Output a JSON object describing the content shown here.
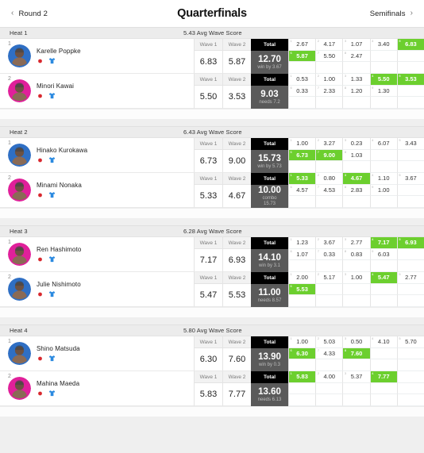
{
  "nav": {
    "prev_label": "Round 2",
    "prev_icon": "chevron-left-icon",
    "title": "Quarterfinals",
    "next_label": "Semifinals",
    "next_icon": "chevron-right-icon"
  },
  "columns": {
    "wave1": "Wave 1",
    "wave2": "Wave 2",
    "total": "Total"
  },
  "colors": {
    "highlight_green": "#6ccf2e",
    "total_header_bg": "#000000",
    "total_value_bg": "#5a5a5a",
    "heat_header_bg": "#ececec",
    "page_bg": "#efefef"
  },
  "heats": [
    {
      "label": "Heat 1",
      "avg": "5.43 Avg Wave Score",
      "athletes": [
        {
          "rank": "1",
          "name": "Karelle Poppke",
          "avatar_color": "#2f6fc4",
          "flag_icon": "flag-icon",
          "jersey_icon": "jersey-icon",
          "wave1": "6.83",
          "wave2": "5.87",
          "total": "12.70",
          "note": "win by 3.67",
          "note2": "",
          "waves": [
            [
              {
                "v": "2.67",
                "n": "1",
                "hl": false
              },
              {
                "v": "4.17",
                "n": "2",
                "hl": false
              },
              {
                "v": "1.07",
                "n": "3",
                "hl": false
              },
              {
                "v": "3.40",
                "n": "4",
                "hl": false
              },
              {
                "v": "6.83",
                "n": "5",
                "hl": true
              }
            ],
            [
              {
                "v": "5.87",
                "n": "6",
                "hl": true
              },
              {
                "v": "5.50",
                "n": "7",
                "hl": false
              },
              {
                "v": "2.47",
                "n": "8",
                "hl": false
              },
              {
                "v": "",
                "n": "",
                "hl": false
              },
              {
                "v": "",
                "n": "",
                "hl": false
              }
            ],
            [
              {
                "v": "",
                "n": "",
                "hl": false
              },
              {
                "v": "",
                "n": "",
                "hl": false
              },
              {
                "v": "",
                "n": "",
                "hl": false
              },
              {
                "v": "",
                "n": "",
                "hl": false
              },
              {
                "v": "",
                "n": "",
                "hl": false
              }
            ]
          ]
        },
        {
          "rank": "2",
          "name": "Minori Kawai",
          "avatar_color": "#e0209a",
          "flag_icon": "flag-icon",
          "jersey_icon": "jersey-icon",
          "wave1": "5.50",
          "wave2": "3.53",
          "total": "9.03",
          "note": "needs 7.2",
          "note2": "",
          "waves": [
            [
              {
                "v": "0.53",
                "n": "1",
                "hl": false
              },
              {
                "v": "1.00",
                "n": "2",
                "hl": false
              },
              {
                "v": "1.33",
                "n": "3",
                "hl": false
              },
              {
                "v": "5.50",
                "n": "4",
                "hl": true
              },
              {
                "v": "3.53",
                "n": "5",
                "hl": true
              }
            ],
            [
              {
                "v": "0.33",
                "n": "6",
                "hl": false
              },
              {
                "v": "2.33",
                "n": "7",
                "hl": false
              },
              {
                "v": "1.20",
                "n": "8",
                "hl": false
              },
              {
                "v": "1.30",
                "n": "9",
                "hl": false
              },
              {
                "v": "",
                "n": "",
                "hl": false
              }
            ],
            [
              {
                "v": "",
                "n": "",
                "hl": false
              },
              {
                "v": "",
                "n": "",
                "hl": false
              },
              {
                "v": "",
                "n": "",
                "hl": false
              },
              {
                "v": "",
                "n": "",
                "hl": false
              },
              {
                "v": "",
                "n": "",
                "hl": false
              }
            ]
          ]
        }
      ]
    },
    {
      "label": "Heat 2",
      "avg": "6.43 Avg Wave Score",
      "athletes": [
        {
          "rank": "1",
          "name": "Hinako Kurokawa",
          "avatar_color": "#2f6fc4",
          "flag_icon": "flag-icon",
          "jersey_icon": "jersey-icon",
          "wave1": "6.73",
          "wave2": "9.00",
          "total": "15.73",
          "note": "win by 5.73",
          "note2": "",
          "waves": [
            [
              {
                "v": "1.00",
                "n": "1",
                "hl": false
              },
              {
                "v": "3.27",
                "n": "2",
                "hl": false
              },
              {
                "v": "0.23",
                "n": "3",
                "hl": false
              },
              {
                "v": "6.07",
                "n": "4",
                "hl": false
              },
              {
                "v": "3.43",
                "n": "5",
                "hl": false
              }
            ],
            [
              {
                "v": "6.73",
                "n": "6",
                "hl": true
              },
              {
                "v": "9.00",
                "n": "7",
                "hl": true
              },
              {
                "v": "1.03",
                "n": "8",
                "hl": false
              },
              {
                "v": "",
                "n": "",
                "hl": false
              },
              {
                "v": "",
                "n": "",
                "hl": false
              }
            ],
            [
              {
                "v": "",
                "n": "",
                "hl": false
              },
              {
                "v": "",
                "n": "",
                "hl": false
              },
              {
                "v": "",
                "n": "",
                "hl": false
              },
              {
                "v": "",
                "n": "",
                "hl": false
              },
              {
                "v": "",
                "n": "",
                "hl": false
              }
            ]
          ]
        },
        {
          "rank": "2",
          "name": "Minami Nonaka",
          "avatar_color": "#e0209a",
          "flag_icon": "flag-icon",
          "jersey_icon": "jersey-icon",
          "wave1": "5.33",
          "wave2": "4.67",
          "total": "10.00",
          "note": "combo",
          "note2": "15.73",
          "waves": [
            [
              {
                "v": "5.33",
                "n": "1",
                "hl": true
              },
              {
                "v": "0.80",
                "n": "2",
                "hl": false
              },
              {
                "v": "4.67",
                "n": "3",
                "hl": true
              },
              {
                "v": "1.10",
                "n": "4",
                "hl": false
              },
              {
                "v": "3.67",
                "n": "5",
                "hl": false
              }
            ],
            [
              {
                "v": "4.57",
                "n": "6",
                "hl": false
              },
              {
                "v": "4.53",
                "n": "7",
                "hl": false
              },
              {
                "v": "2.83",
                "n": "8",
                "hl": false
              },
              {
                "v": "1.00",
                "n": "9",
                "hl": false
              },
              {
                "v": "",
                "n": "",
                "hl": false
              }
            ],
            [
              {
                "v": "",
                "n": "",
                "hl": false
              },
              {
                "v": "",
                "n": "",
                "hl": false
              },
              {
                "v": "",
                "n": "",
                "hl": false
              },
              {
                "v": "",
                "n": "",
                "hl": false
              },
              {
                "v": "",
                "n": "",
                "hl": false
              }
            ]
          ]
        }
      ]
    },
    {
      "label": "Heat 3",
      "avg": "6.28 Avg Wave Score",
      "athletes": [
        {
          "rank": "1",
          "name": "Ren Hashimoto",
          "avatar_color": "#e0209a",
          "flag_icon": "flag-icon",
          "jersey_icon": "jersey-icon",
          "wave1": "7.17",
          "wave2": "6.93",
          "total": "14.10",
          "note": "win by 3.1",
          "note2": "",
          "waves": [
            [
              {
                "v": "1.23",
                "n": "1",
                "hl": false
              },
              {
                "v": "3.67",
                "n": "2",
                "hl": false
              },
              {
                "v": "2.77",
                "n": "3",
                "hl": false
              },
              {
                "v": "7.17",
                "n": "4",
                "hl": true
              },
              {
                "v": "6.93",
                "n": "5",
                "hl": true
              }
            ],
            [
              {
                "v": "1.07",
                "n": "6",
                "hl": false
              },
              {
                "v": "0.33",
                "n": "7",
                "hl": false
              },
              {
                "v": "0.83",
                "n": "8",
                "hl": false
              },
              {
                "v": "6.03",
                "n": "9",
                "hl": false
              },
              {
                "v": "",
                "n": "",
                "hl": false
              }
            ],
            [
              {
                "v": "",
                "n": "",
                "hl": false
              },
              {
                "v": "",
                "n": "",
                "hl": false
              },
              {
                "v": "",
                "n": "",
                "hl": false
              },
              {
                "v": "",
                "n": "",
                "hl": false
              },
              {
                "v": "",
                "n": "",
                "hl": false
              }
            ]
          ]
        },
        {
          "rank": "2",
          "name": "Julie Nishimoto",
          "avatar_color": "#2f6fc4",
          "flag_icon": "flag-icon",
          "jersey_icon": "jersey-icon",
          "wave1": "5.47",
          "wave2": "5.53",
          "total": "11.00",
          "note": "needs 8.57",
          "note2": "",
          "waves": [
            [
              {
                "v": "2.00",
                "n": "1",
                "hl": false
              },
              {
                "v": "5.17",
                "n": "2",
                "hl": false
              },
              {
                "v": "1.00",
                "n": "3",
                "hl": false
              },
              {
                "v": "5.47",
                "n": "4",
                "hl": true
              },
              {
                "v": "2.77",
                "n": "5",
                "hl": false
              }
            ],
            [
              {
                "v": "5.53",
                "n": "6",
                "hl": true
              },
              {
                "v": "",
                "n": "",
                "hl": false
              },
              {
                "v": "",
                "n": "",
                "hl": false
              },
              {
                "v": "",
                "n": "",
                "hl": false
              },
              {
                "v": "",
                "n": "",
                "hl": false
              }
            ],
            [
              {
                "v": "",
                "n": "",
                "hl": false
              },
              {
                "v": "",
                "n": "",
                "hl": false
              },
              {
                "v": "",
                "n": "",
                "hl": false
              },
              {
                "v": "",
                "n": "",
                "hl": false
              },
              {
                "v": "",
                "n": "",
                "hl": false
              }
            ]
          ]
        }
      ]
    },
    {
      "label": "Heat 4",
      "avg": "5.80 Avg Wave Score",
      "athletes": [
        {
          "rank": "1",
          "name": "Shino Matsuda",
          "avatar_color": "#2f6fc4",
          "flag_icon": "flag-icon",
          "jersey_icon": "jersey-icon",
          "wave1": "6.30",
          "wave2": "7.60",
          "total": "13.90",
          "note": "win by 0.3",
          "note2": "",
          "waves": [
            [
              {
                "v": "1.00",
                "n": "1",
                "hl": false
              },
              {
                "v": "5.03",
                "n": "2",
                "hl": false
              },
              {
                "v": "0.50",
                "n": "3",
                "hl": false
              },
              {
                "v": "4.10",
                "n": "4",
                "hl": false
              },
              {
                "v": "5.70",
                "n": "5",
                "hl": false
              }
            ],
            [
              {
                "v": "6.30",
                "n": "6",
                "hl": true
              },
              {
                "v": "4.33",
                "n": "7",
                "hl": false
              },
              {
                "v": "7.60",
                "n": "8",
                "hl": true
              },
              {
                "v": "",
                "n": "",
                "hl": false
              },
              {
                "v": "",
                "n": "",
                "hl": false
              }
            ],
            [
              {
                "v": "",
                "n": "",
                "hl": false
              },
              {
                "v": "",
                "n": "",
                "hl": false
              },
              {
                "v": "",
                "n": "",
                "hl": false
              },
              {
                "v": "",
                "n": "",
                "hl": false
              },
              {
                "v": "",
                "n": "",
                "hl": false
              }
            ]
          ]
        },
        {
          "rank": "2",
          "name": "Mahina Maeda",
          "avatar_color": "#e0209a",
          "flag_icon": "flag-icon",
          "jersey_icon": "jersey-icon",
          "wave1": "5.83",
          "wave2": "7.77",
          "total": "13.60",
          "note": "needs 6.13",
          "note2": "",
          "waves": [
            [
              {
                "v": "5.83",
                "n": "1",
                "hl": true
              },
              {
                "v": "4.00",
                "n": "2",
                "hl": false
              },
              {
                "v": "5.37",
                "n": "3",
                "hl": false
              },
              {
                "v": "7.77",
                "n": "4",
                "hl": true
              },
              {
                "v": "",
                "n": "",
                "hl": false
              }
            ],
            [
              {
                "v": "",
                "n": "",
                "hl": false
              },
              {
                "v": "",
                "n": "",
                "hl": false
              },
              {
                "v": "",
                "n": "",
                "hl": false
              },
              {
                "v": "",
                "n": "",
                "hl": false
              },
              {
                "v": "",
                "n": "",
                "hl": false
              }
            ],
            [
              {
                "v": "",
                "n": "",
                "hl": false
              },
              {
                "v": "",
                "n": "",
                "hl": false
              },
              {
                "v": "",
                "n": "",
                "hl": false
              },
              {
                "v": "",
                "n": "",
                "hl": false
              },
              {
                "v": "",
                "n": "",
                "hl": false
              }
            ]
          ]
        }
      ]
    }
  ]
}
